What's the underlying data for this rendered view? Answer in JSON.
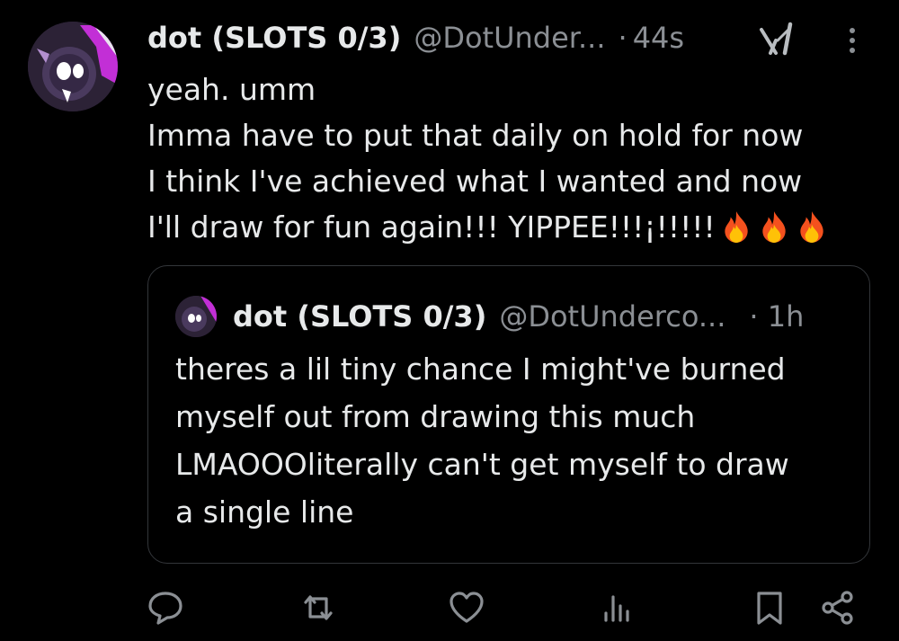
{
  "post": {
    "author_name": "dot (SLOTS 0/3)",
    "handle": "@DotUnder...",
    "separator": "·",
    "time": "44s",
    "text_lines": [
      "yeah. umm",
      "Imma have to put that daily on hold for now",
      "I think I've achieved what I wanted and now",
      "I'll draw for fun again!!! YIPPEE!!!¡!!!!!"
    ],
    "emoji": [
      "🔥",
      "🔥",
      "🔥"
    ]
  },
  "quoted_post": {
    "author_name": "dot (SLOTS 0/3)",
    "handle": "@DotUnderco...",
    "time": "· 1h",
    "text_lines": [
      "theres a lil tiny chance I might've burned",
      "myself out from drawing this much",
      "LMAOOOliterally can't get myself to draw",
      "a single line"
    ]
  },
  "actions": {
    "reply": "reply-icon",
    "repost": "repost-icon",
    "like": "heart-icon",
    "views": "views-icon",
    "bookmark": "bookmark-icon",
    "share": "share-icon"
  },
  "colors": {
    "background": "#000000",
    "text": "#e7e9ea",
    "secondary_text": "#8b8f94",
    "border": "#33363a",
    "avatar_accent": "#c22fd6"
  }
}
